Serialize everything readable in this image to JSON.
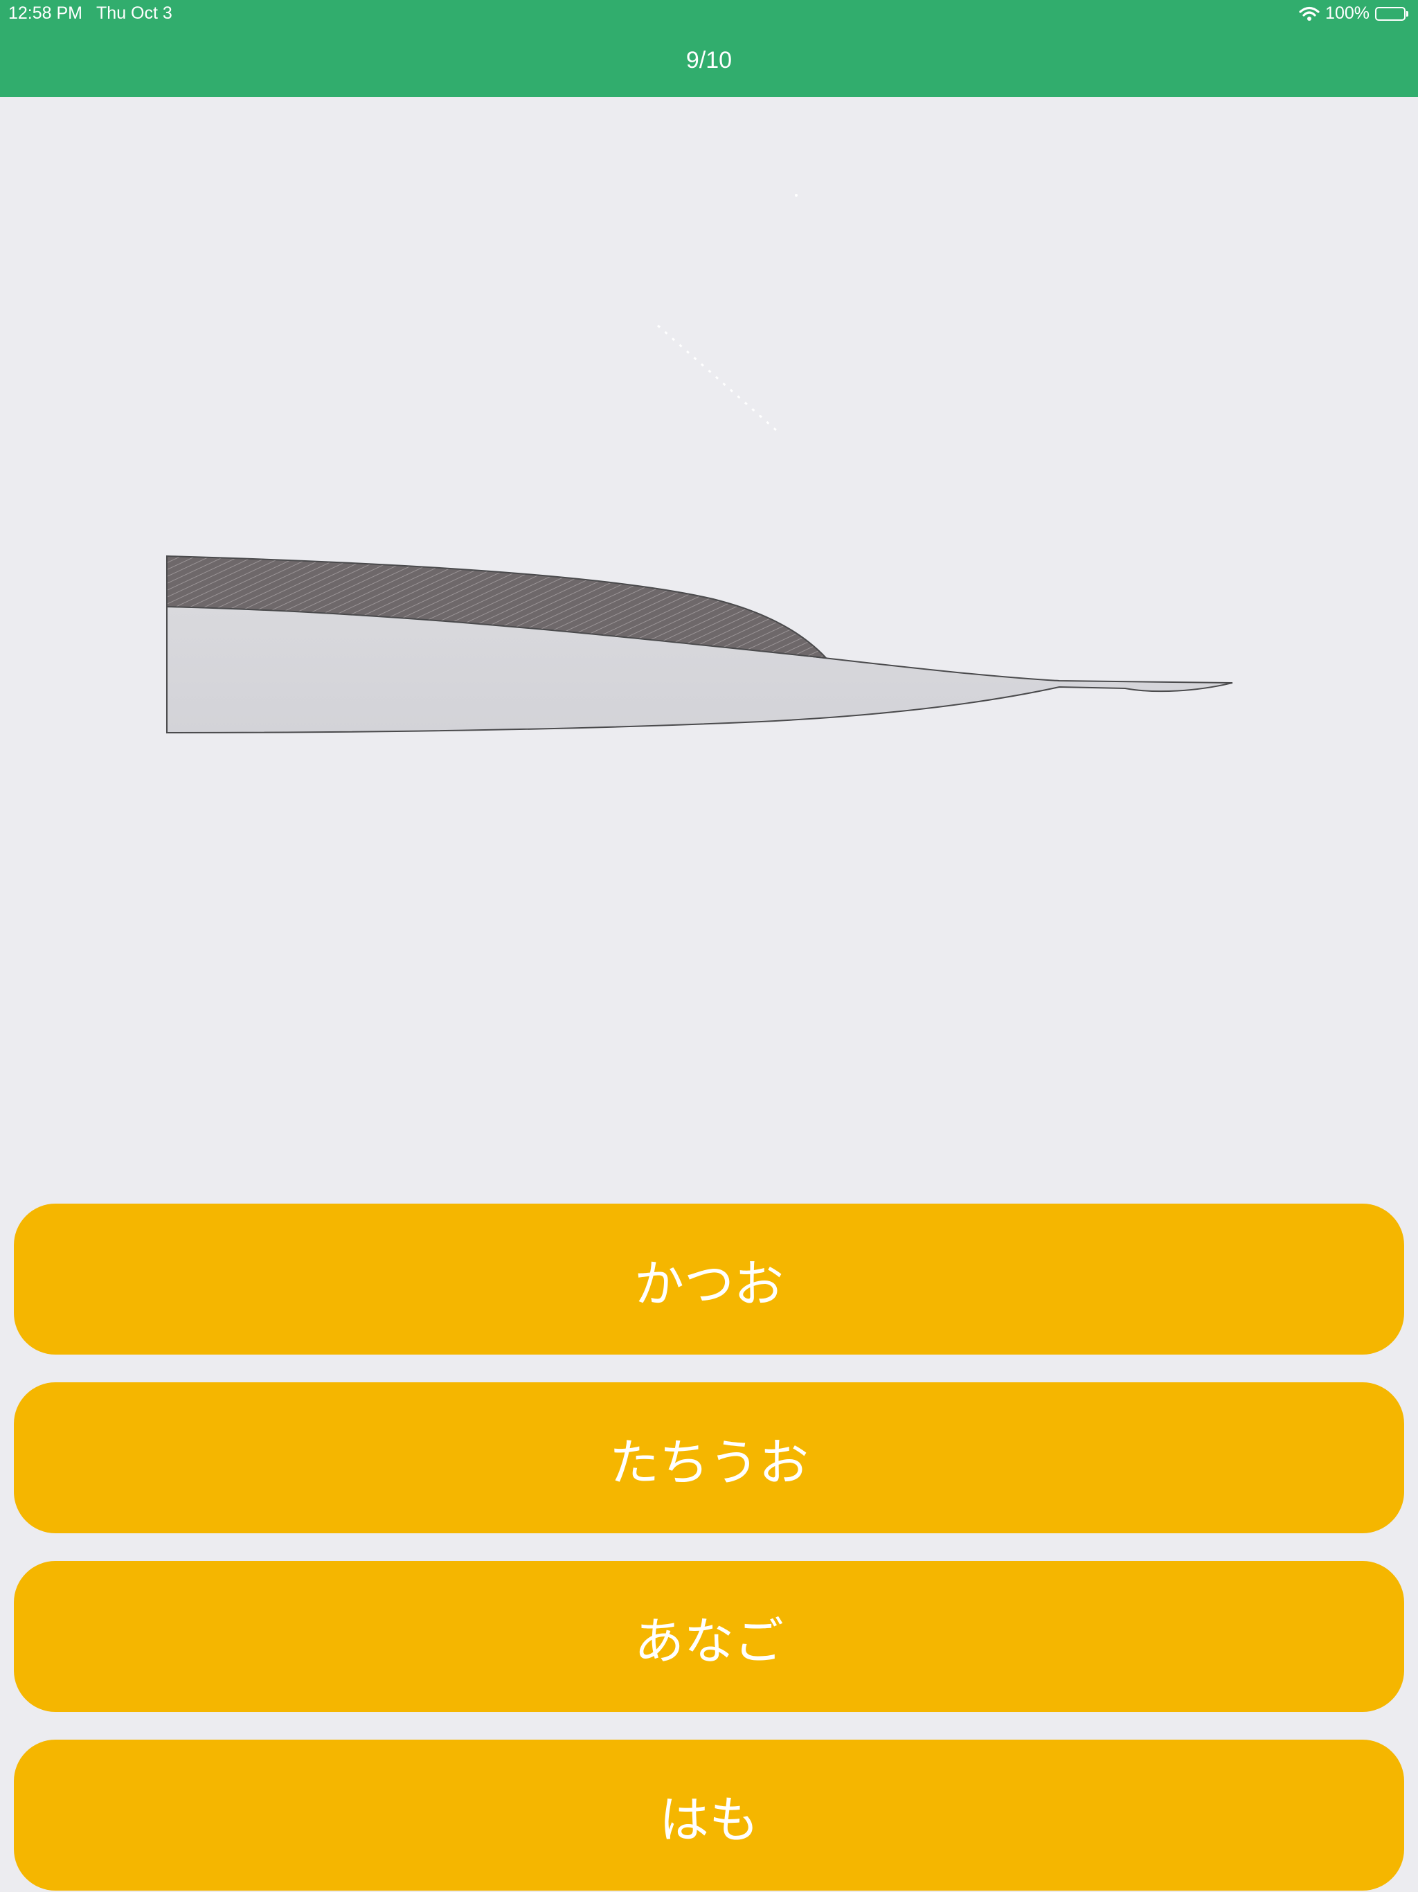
{
  "status_bar": {
    "time": "12:58 PM",
    "date": "Thu Oct 3",
    "battery": "100%",
    "battery_level": 1.0,
    "icons": [
      "wifi-icon",
      "battery-icon"
    ]
  },
  "nav": {
    "progress": "9/10"
  },
  "quiz": {
    "image": "fish-illustration",
    "answers": [
      "かつお",
      "たちうお",
      "あなご",
      "はも"
    ]
  },
  "colors": {
    "nav_bar": "#31ad6d",
    "background": "#ececf0",
    "answer_button": "#f5b600",
    "answer_text": "#ffffff"
  }
}
